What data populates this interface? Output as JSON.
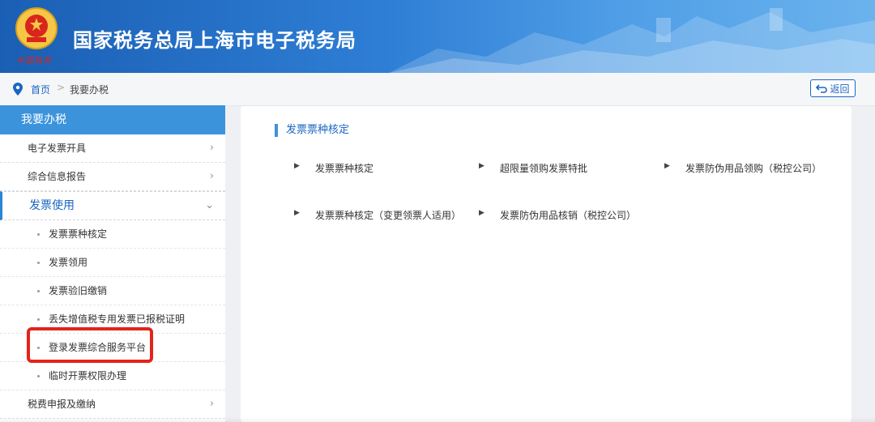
{
  "header": {
    "title": "国家税务总局上海市电子税务局",
    "emblem_text": "中国税务"
  },
  "breadcrumb": {
    "home": "首页",
    "separator": ">",
    "current": "我要办税",
    "back_label": "返回"
  },
  "sidebar": {
    "heading": "我要办税",
    "items": [
      {
        "label": "电子发票开具",
        "chevron": "›"
      },
      {
        "label": "综合信息报告",
        "chevron": "›"
      },
      {
        "label": "发票使用",
        "chevron": "⌄"
      }
    ],
    "subitems": [
      "发票票种核定",
      "发票领用",
      "发票验旧缴销",
      "丢失增值税专用发票已报税证明",
      "登录发票综合服务平台",
      "临时开票权限办理"
    ],
    "bottom_item": {
      "label": "税费申报及缴纳",
      "chevron": "›"
    }
  },
  "main": {
    "section_title": "发票票种核定",
    "links": [
      "发票票种核定",
      "超限量领购发票特批",
      "发票防伪用品领购（税控公司）",
      "发票票种核定（变更领票人适用）",
      "发票防伪用品核销（税控公司）"
    ]
  },
  "colors": {
    "header_start": "#1a5fb4",
    "header_end": "#6bb3ee",
    "sidebar_head": "#3b93dc",
    "link_blue": "#1a66c2",
    "highlight_red": "#e3241b"
  }
}
